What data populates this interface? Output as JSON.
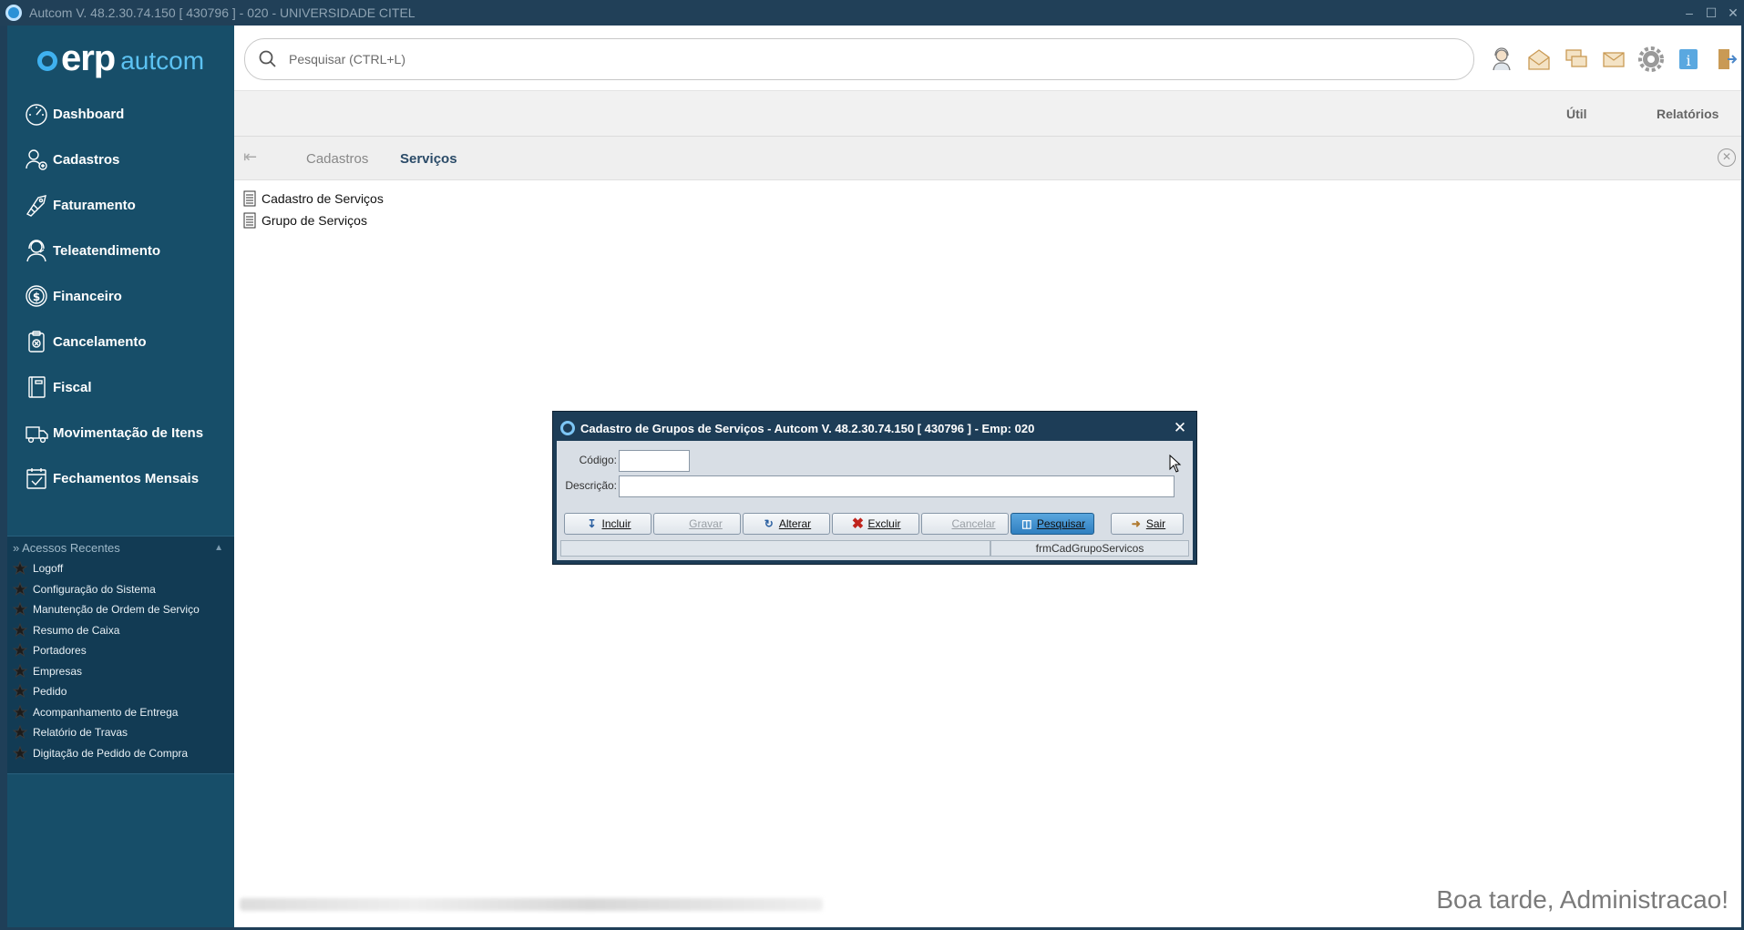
{
  "window": {
    "title": "Autcom V. 48.2.30.74.150 [ 430796 ] - 020 - UNIVERSIDADE CITEL"
  },
  "logo": {
    "erp": "erp",
    "autcom": "autcom"
  },
  "sidebar": {
    "menu": [
      {
        "label": "Dashboard",
        "icon": "speedometer-icon"
      },
      {
        "label": "Cadastros",
        "icon": "user-add-icon"
      },
      {
        "label": "Faturamento",
        "icon": "tag-icon"
      },
      {
        "label": "Teleatendimento",
        "icon": "headset-icon"
      },
      {
        "label": "Financeiro",
        "icon": "dollar-icon"
      },
      {
        "label": "Cancelamento",
        "icon": "clipboard-cancel-icon"
      },
      {
        "label": "Fiscal",
        "icon": "document-icon"
      },
      {
        "label": "Movimentação de Itens",
        "icon": "truck-icon"
      },
      {
        "label": "Fechamentos Mensais",
        "icon": "calendar-check-icon"
      }
    ],
    "recent": {
      "title": "» Acessos Recentes",
      "items": [
        "Logoff",
        "Configuração do Sistema",
        "Manutenção de Ordem de Serviço",
        "Resumo de Caixa",
        "Portadores",
        "Empresas",
        "Pedido",
        "Acompanhamento de Entrega",
        "Relatório de Travas",
        "Digitação de Pedido de Compra"
      ]
    }
  },
  "search": {
    "placeholder": "Pesquisar (CTRL+L)"
  },
  "toolbar_icons": [
    "support-agent-icon",
    "mail-open-icon",
    "chat-icon",
    "envelope-icon",
    "gear-icon",
    "info-icon",
    "exit-door-icon"
  ],
  "menubar": {
    "util": "Útil",
    "relatorios": "Relatórios"
  },
  "breadcrumb": {
    "parent": "Cadastros",
    "current": "Serviços"
  },
  "content": {
    "links": [
      "Cadastro de Serviços",
      "Grupo de Serviços"
    ]
  },
  "greeting": "Boa tarde, Administracao!",
  "dialog": {
    "title": "Cadastro de Grupos de Serviços   -   Autcom V. 48.2.30.74.150 [ 430796 ] - Emp: 020",
    "codigo_label": "Código:",
    "codigo_value": "",
    "descricao_label": "Descrição:",
    "descricao_value": "",
    "buttons": {
      "incluir": "Incluir",
      "gravar": "Gravar",
      "alterar": "Alterar",
      "excluir": "Excluir",
      "cancelar": "Cancelar",
      "pesquisar": "Pesquisar",
      "sair": "Sair"
    },
    "status_left": "",
    "status_right": "frmCadGrupoServicos"
  }
}
